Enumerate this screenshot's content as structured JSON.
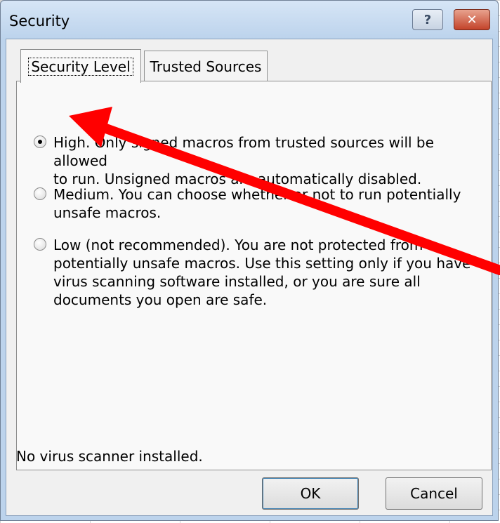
{
  "window": {
    "title": "Security",
    "help_glyph": "?",
    "close_glyph": "✕"
  },
  "tabs": [
    {
      "label": "Security Level",
      "active": true
    },
    {
      "label": "Trusted Sources",
      "active": false
    }
  ],
  "security_options": [
    {
      "label": "High. Only signed macros from trusted sources will be allowed\nto run. Unsigned macros are automatically disabled.",
      "selected": true
    },
    {
      "label": "Medium. You can choose whether or not to run potentially\nunsafe macros.",
      "selected": false
    },
    {
      "label": "Low (not recommended). You are not protected from\npotentially unsafe macros. Use this setting only if you have\nvirus scanning software installed, or you are sure all\ndocuments you open are safe.",
      "selected": false
    }
  ],
  "status_text": "No virus scanner installed.",
  "buttons": {
    "ok": "OK",
    "cancel": "Cancel"
  },
  "colors": {
    "annotation_arrow": "#ff0000"
  },
  "icons": {
    "help": "help-icon",
    "close": "close-icon"
  }
}
